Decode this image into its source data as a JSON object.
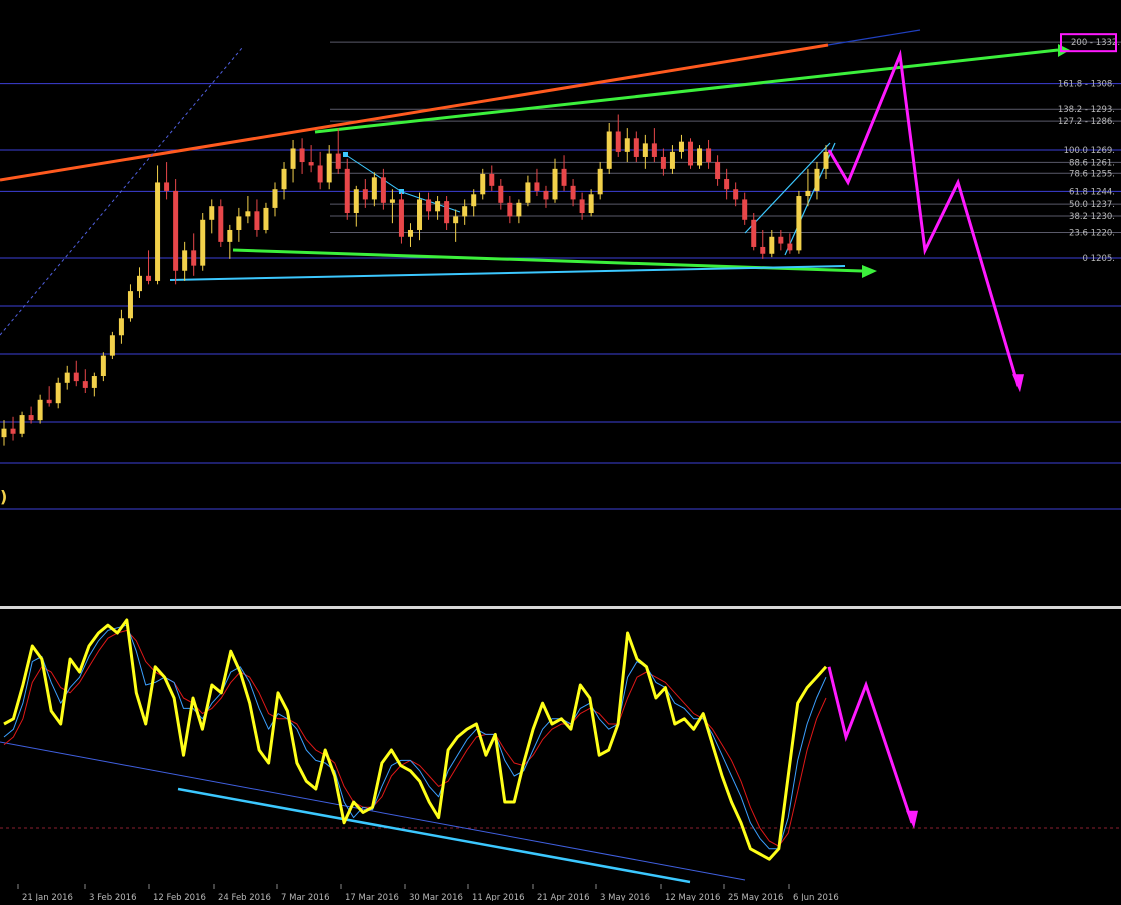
{
  "colors": {
    "background": "#000000",
    "bull_candle": "#f2d14b",
    "bear_candle": "#e8474a",
    "fib_level": "#3d40d8",
    "fib_label": "#b8b8b8",
    "trend_red": "#ff5a1f",
    "trend_green": "#3cf03c",
    "trend_cyan": "#3cc8ff",
    "projection": "#ff1aff",
    "stoch_main": "#ffff1a",
    "stoch_signal": "#e01818",
    "stoch_blue": "#3ca0ff",
    "divider": "#d8d8d8"
  },
  "chart_data": [
    {
      "type": "candlestick",
      "title": "",
      "xlabel": "",
      "ylabel": "",
      "price_axis_label": "1332.",
      "left_edge_glyph": ")",
      "fib_levels": [
        {
          "label": "200 - 1332.",
          "price": 1332.6,
          "highlighted": true
        },
        {
          "label": "161.8 - 1308.",
          "price": 1308.2
        },
        {
          "label": "138.2 - 1293.",
          "price": 1293.1
        },
        {
          "label": "127.2 - 1286.",
          "price": 1286.1
        },
        {
          "label": "100.0 1269.",
          "price": 1269.1
        },
        {
          "label": "88.6 1261.",
          "price": 1261.8
        },
        {
          "label": "78.6 1255.",
          "price": 1255.4
        },
        {
          "label": "61.8 1244.",
          "price": 1244.7
        },
        {
          "label": "50.0 1237.",
          "price": 1237.2
        },
        {
          "label": "38.2 1230.",
          "price": 1230.2
        },
        {
          "label": "23.6 1220.",
          "price": 1220.5
        },
        {
          "label": "0 1205.",
          "price": 1205.5
        }
      ],
      "candles": [
        [
          1100,
          1110,
          1095,
          1105
        ],
        [
          1105,
          1112,
          1098,
          1102
        ],
        [
          1102,
          1115,
          1100,
          1113
        ],
        [
          1113,
          1118,
          1108,
          1110
        ],
        [
          1110,
          1125,
          1108,
          1122
        ],
        [
          1122,
          1130,
          1118,
          1120
        ],
        [
          1120,
          1135,
          1117,
          1132
        ],
        [
          1132,
          1142,
          1128,
          1138
        ],
        [
          1138,
          1145,
          1130,
          1133
        ],
        [
          1133,
          1140,
          1126,
          1129
        ],
        [
          1129,
          1138,
          1124,
          1136
        ],
        [
          1136,
          1150,
          1133,
          1148
        ],
        [
          1148,
          1162,
          1146,
          1160
        ],
        [
          1160,
          1175,
          1155,
          1170
        ],
        [
          1170,
          1190,
          1168,
          1186
        ],
        [
          1186,
          1200,
          1182,
          1195
        ],
        [
          1195,
          1210,
          1190,
          1192
        ],
        [
          1192,
          1260,
          1190,
          1250
        ],
        [
          1250,
          1262,
          1240,
          1245
        ],
        [
          1245,
          1252,
          1190,
          1198
        ],
        [
          1198,
          1215,
          1192,
          1210
        ],
        [
          1210,
          1220,
          1195,
          1201
        ],
        [
          1201,
          1232,
          1198,
          1228
        ],
        [
          1228,
          1240,
          1220,
          1236
        ],
        [
          1236,
          1240,
          1212,
          1215
        ],
        [
          1215,
          1225,
          1205,
          1222
        ],
        [
          1222,
          1235,
          1215,
          1230
        ],
        [
          1230,
          1242,
          1226,
          1233
        ],
        [
          1233,
          1240,
          1218,
          1222
        ],
        [
          1222,
          1238,
          1220,
          1235
        ],
        [
          1235,
          1250,
          1230,
          1246
        ],
        [
          1246,
          1262,
          1240,
          1258
        ],
        [
          1258,
          1275,
          1250,
          1270
        ],
        [
          1270,
          1276,
          1255,
          1262
        ],
        [
          1262,
          1272,
          1256,
          1260
        ],
        [
          1260,
          1268,
          1246,
          1250
        ],
        [
          1250,
          1272,
          1246,
          1267
        ],
        [
          1267,
          1282,
          1255,
          1258
        ],
        [
          1258,
          1264,
          1228,
          1232
        ],
        [
          1232,
          1248,
          1224,
          1246
        ],
        [
          1246,
          1252,
          1235,
          1240
        ],
        [
          1240,
          1256,
          1236,
          1253
        ],
        [
          1253,
          1258,
          1234,
          1238
        ],
        [
          1238,
          1246,
          1226,
          1240
        ],
        [
          1240,
          1244,
          1214,
          1218
        ],
        [
          1218,
          1226,
          1212,
          1222
        ],
        [
          1222,
          1244,
          1216,
          1240
        ],
        [
          1240,
          1244,
          1228,
          1233
        ],
        [
          1233,
          1242,
          1228,
          1239
        ],
        [
          1239,
          1242,
          1222,
          1226
        ],
        [
          1226,
          1234,
          1215,
          1230
        ],
        [
          1230,
          1240,
          1225,
          1236
        ],
        [
          1236,
          1246,
          1230,
          1243
        ],
        [
          1243,
          1258,
          1240,
          1255
        ],
        [
          1255,
          1260,
          1245,
          1248
        ],
        [
          1248,
          1252,
          1234,
          1238
        ],
        [
          1238,
          1242,
          1226,
          1230
        ],
        [
          1230,
          1240,
          1226,
          1238
        ],
        [
          1238,
          1254,
          1236,
          1250
        ],
        [
          1250,
          1258,
          1242,
          1245
        ],
        [
          1245,
          1248,
          1235,
          1240
        ],
        [
          1240,
          1264,
          1238,
          1258
        ],
        [
          1258,
          1266,
          1245,
          1248
        ],
        [
          1248,
          1252,
          1236,
          1240
        ],
        [
          1240,
          1244,
          1228,
          1232
        ],
        [
          1232,
          1246,
          1230,
          1243
        ],
        [
          1243,
          1262,
          1240,
          1258
        ],
        [
          1258,
          1285,
          1255,
          1280
        ],
        [
          1280,
          1290,
          1265,
          1268
        ],
        [
          1268,
          1282,
          1262,
          1276
        ],
        [
          1276,
          1280,
          1262,
          1265
        ],
        [
          1265,
          1278,
          1258,
          1273
        ],
        [
          1273,
          1282,
          1262,
          1265
        ],
        [
          1265,
          1270,
          1254,
          1258
        ],
        [
          1258,
          1272,
          1255,
          1268
        ],
        [
          1268,
          1278,
          1264,
          1274
        ],
        [
          1274,
          1276,
          1258,
          1260
        ],
        [
          1260,
          1272,
          1258,
          1270
        ],
        [
          1270,
          1275,
          1258,
          1262
        ],
        [
          1262,
          1266,
          1248,
          1252
        ],
        [
          1252,
          1258,
          1240,
          1246
        ],
        [
          1246,
          1250,
          1236,
          1240
        ],
        [
          1240,
          1244,
          1225,
          1228
        ],
        [
          1228,
          1232,
          1210,
          1212
        ],
        [
          1212,
          1222,
          1205,
          1208
        ],
        [
          1208,
          1222,
          1206,
          1218
        ],
        [
          1218,
          1222,
          1210,
          1214
        ],
        [
          1214,
          1220,
          1208,
          1210
        ],
        [
          1210,
          1245,
          1208,
          1242
        ],
        [
          1242,
          1258,
          1236,
          1245
        ],
        [
          1245,
          1262,
          1240,
          1258
        ],
        [
          1258,
          1272,
          1252,
          1268
        ]
      ],
      "projection_path": [
        [
          1269,
          0
        ],
        [
          1250,
          2
        ],
        [
          1325,
          6
        ],
        [
          1210,
          11
        ],
        [
          1250,
          15
        ],
        [
          1130,
          22
        ]
      ]
    },
    {
      "type": "line",
      "title": "",
      "ylim": [
        0,
        100
      ],
      "reference_level": 20,
      "x_tick_labels": [
        "21 Jan 2016",
        "3 Feb 2016",
        "12 Feb 2016",
        "24 Feb 2016",
        "7 Mar 2016",
        "17 Mar 2016",
        "30 Mar 2016",
        "11 Apr 2016",
        "21 Apr 2016",
        "3 May 2016",
        "12 May 2016",
        "25 May 2016",
        "6 Jun 2016"
      ],
      "series": [
        {
          "values": [
            60,
            62,
            75,
            90,
            85,
            65,
            60,
            85,
            80,
            90,
            95,
            98,
            95,
            100,
            72,
            60,
            82,
            78,
            70,
            48,
            70,
            58,
            75,
            72,
            88,
            80,
            68,
            50,
            45,
            72,
            65,
            45,
            38,
            35,
            50,
            40,
            22,
            30,
            26,
            28,
            45,
            50,
            44,
            42,
            38,
            30,
            24,
            50,
            55,
            58,
            60,
            48,
            56,
            30,
            30,
            45,
            58,
            68,
            60,
            62,
            58,
            75,
            70,
            48,
            50,
            60,
            95,
            85,
            82,
            70,
            74,
            60,
            62,
            58,
            64,
            52,
            40,
            30,
            22,
            12,
            10,
            8,
            12,
            40,
            68,
            74,
            78,
            82
          ]
        },
        {
          "values": [
            55,
            58,
            68,
            84,
            86,
            76,
            68,
            74,
            78,
            86,
            92,
            96,
            97,
            98,
            88,
            75,
            76,
            78,
            76,
            66,
            66,
            62,
            68,
            72,
            80,
            82,
            76,
            66,
            58,
            64,
            62,
            58,
            50,
            46,
            45,
            42,
            30,
            24,
            28,
            27,
            36,
            44,
            46,
            46,
            42,
            36,
            32,
            42,
            48,
            54,
            58,
            56,
            56,
            46,
            40,
            42,
            50,
            58,
            62,
            62,
            60,
            66,
            68,
            62,
            58,
            60,
            78,
            84,
            82,
            76,
            74,
            68,
            66,
            62,
            62,
            56,
            48,
            40,
            32,
            22,
            16,
            12,
            12,
            24,
            46,
            60,
            70,
            78
          ]
        },
        {
          "values": [
            52,
            55,
            62,
            76,
            82,
            80,
            74,
            72,
            76,
            82,
            88,
            93,
            95,
            96,
            92,
            84,
            80,
            78,
            76,
            70,
            68,
            64,
            66,
            70,
            76,
            80,
            78,
            72,
            64,
            62,
            62,
            60,
            54,
            50,
            48,
            45,
            36,
            30,
            28,
            28,
            32,
            40,
            44,
            46,
            44,
            40,
            36,
            38,
            44,
            50,
            55,
            56,
            56,
            50,
            45,
            44,
            48,
            54,
            58,
            60,
            60,
            64,
            66,
            64,
            60,
            60,
            70,
            78,
            80,
            78,
            76,
            72,
            68,
            64,
            62,
            58,
            52,
            46,
            38,
            28,
            20,
            15,
            13,
            18,
            34,
            50,
            62,
            70
          ]
        }
      ],
      "projection_path": [
        [
          82,
          0
        ],
        [
          55,
          1
        ],
        [
          75,
          2
        ],
        [
          22,
          5
        ]
      ]
    }
  ]
}
